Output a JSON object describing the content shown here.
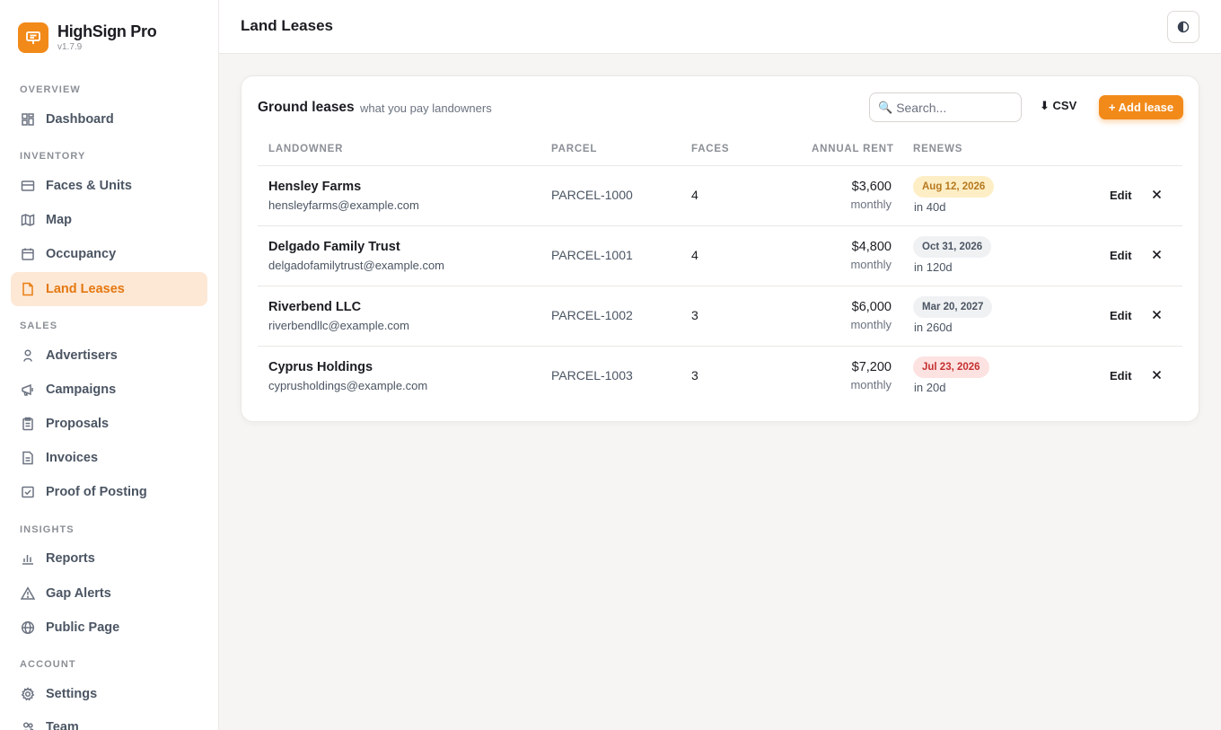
{
  "app": {
    "name": "HighSign Pro",
    "version": "v1.7.9"
  },
  "sidebar": {
    "sections": [
      {
        "label": "OVERVIEW"
      },
      {
        "label": "INVENTORY"
      },
      {
        "label": "SALES"
      },
      {
        "label": "INSIGHTS"
      },
      {
        "label": "ACCOUNT"
      }
    ],
    "items": [
      {
        "label": "Dashboard",
        "icon": "dashboard-icon"
      },
      {
        "label": "Faces & Units",
        "icon": "faces-icon"
      },
      {
        "label": "Map",
        "icon": "map-icon"
      },
      {
        "label": "Occupancy",
        "icon": "calendar-icon"
      },
      {
        "label": "Land Leases",
        "icon": "document-icon",
        "active": true
      },
      {
        "label": "Advertisers",
        "icon": "person-icon"
      },
      {
        "label": "Campaigns",
        "icon": "megaphone-icon"
      },
      {
        "label": "Proposals",
        "icon": "clipboard-icon"
      },
      {
        "label": "Invoices",
        "icon": "invoice-icon"
      },
      {
        "label": "Proof of Posting",
        "icon": "check-square-icon"
      },
      {
        "label": "Reports",
        "icon": "bar-chart-icon"
      },
      {
        "label": "Gap Alerts",
        "icon": "warning-icon"
      },
      {
        "label": "Public Page",
        "icon": "globe-icon"
      },
      {
        "label": "Settings",
        "icon": "gear-icon"
      },
      {
        "label": "Team",
        "icon": "team-icon"
      }
    ]
  },
  "header": {
    "title": "Land Leases",
    "theme_icon": "contrast-icon"
  },
  "card": {
    "title": "Ground leases",
    "subtitle": "what you pay landowners",
    "search_placeholder": "Search...",
    "csv_label": "⬇ CSV",
    "add_label": "+ Add lease",
    "columns": [
      "LANDOWNER",
      "PARCEL",
      "FACES",
      "ANNUAL RENT",
      "RENEWS"
    ],
    "rows": [
      {
        "name": "Hensley Farms",
        "email": "hensleyfarms@example.com",
        "parcel": "PARCEL-1000",
        "faces": "4",
        "rent": "$3,600",
        "period": "monthly",
        "renews": "Aug 12, 2026",
        "due": "in 40d",
        "status": "soon",
        "edit": "Edit"
      },
      {
        "name": "Delgado Family Trust",
        "email": "delgadofamilytrust@example.com",
        "parcel": "PARCEL-1001",
        "faces": "4",
        "rent": "$4,800",
        "period": "monthly",
        "renews": "Oct 31, 2026",
        "due": "in 120d",
        "status": "normal",
        "edit": "Edit"
      },
      {
        "name": "Riverbend LLC",
        "email": "riverbendllc@example.com",
        "parcel": "PARCEL-1002",
        "faces": "3",
        "rent": "$6,000",
        "period": "monthly",
        "renews": "Mar 20, 2027",
        "due": "in 260d",
        "status": "normal",
        "edit": "Edit"
      },
      {
        "name": "Cyprus Holdings",
        "email": "cyprusholdings@example.com",
        "parcel": "PARCEL-1003",
        "faces": "3",
        "rent": "$7,200",
        "period": "monthly",
        "renews": "Jul 23, 2026",
        "due": "in 20d",
        "status": "urgent",
        "edit": "Edit"
      }
    ]
  },
  "colors": {
    "accent": "#f28a1a",
    "active_bg": "#fde8d6",
    "badge_soon_bg": "#fdeec5",
    "badge_soon_fg": "#b7791f",
    "badge_normal_bg": "#f0f1f3",
    "badge_normal_fg": "#4b5563",
    "badge_urgent_bg": "#fde2e2",
    "badge_urgent_fg": "#c53030"
  }
}
